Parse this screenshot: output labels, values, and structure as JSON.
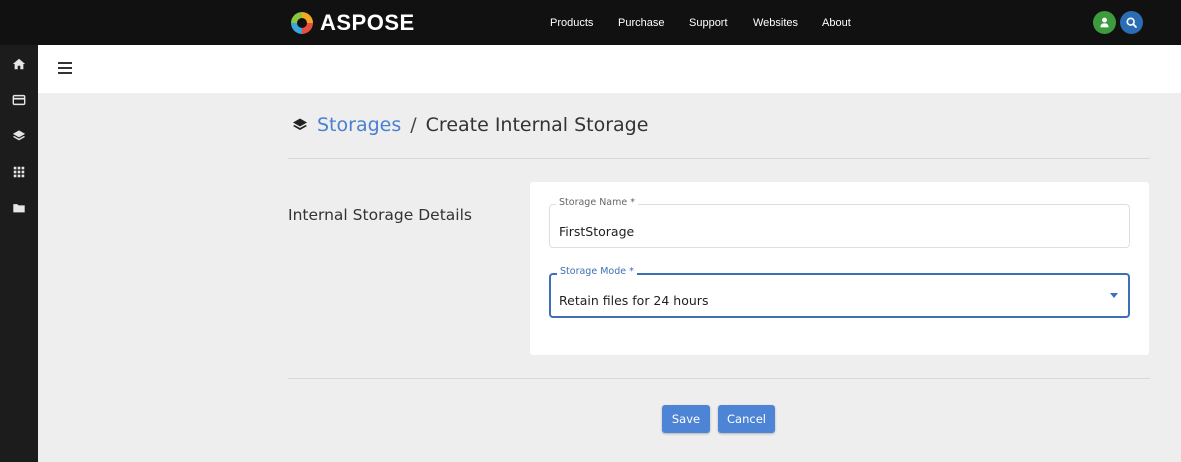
{
  "header": {
    "logo_text": "ASPOSE",
    "nav": [
      "Products",
      "Purchase",
      "Support",
      "Websites",
      "About"
    ],
    "colors": {
      "background": "#111111",
      "user_button": "#3c9b3c",
      "search_button": "#2b6db3"
    }
  },
  "sidebar": {
    "icons": [
      "home-icon",
      "card-icon",
      "layers-icon",
      "apps-grid-icon",
      "folder-icon"
    ]
  },
  "breadcrumb": {
    "parent": "Storages",
    "separator": "/",
    "current": "Create Internal Storage"
  },
  "section": {
    "title": "Internal Storage Details"
  },
  "form": {
    "storage_name": {
      "label": "Storage Name *",
      "value": "FirstStorage"
    },
    "storage_mode": {
      "label": "Storage Mode *",
      "value": "Retain files for 24 hours"
    }
  },
  "actions": {
    "save": "Save",
    "cancel": "Cancel"
  }
}
